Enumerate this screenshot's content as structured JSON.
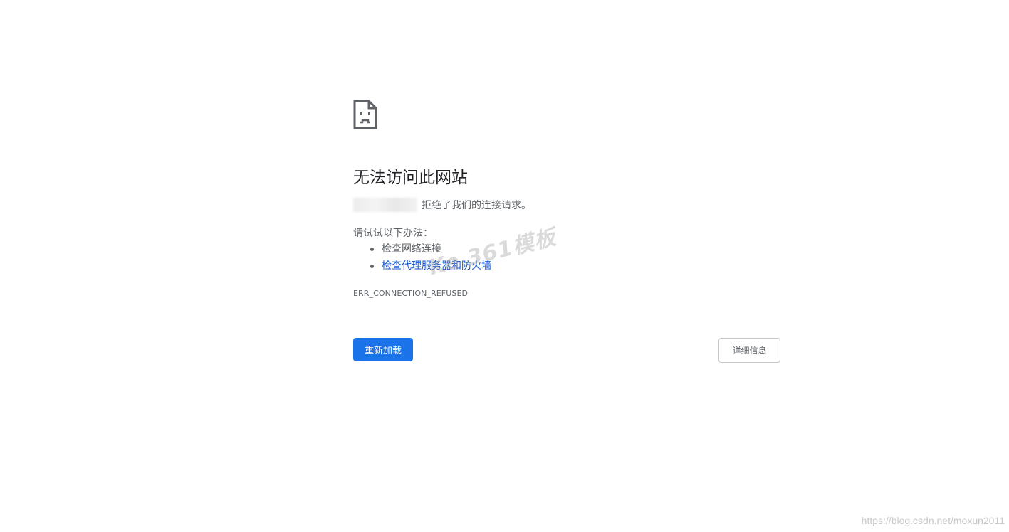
{
  "error_icon": "sad-page-icon",
  "title": "无法访问此网站",
  "summary_text": "拒绝了我们的连接请求。",
  "try_label": "请试试以下办法：",
  "suggestions": [
    {
      "label": "检查网络连接",
      "is_link": false
    },
    {
      "label": "检查代理服务器和防火墙",
      "is_link": true
    }
  ],
  "error_code": "ERR_CONNECTION_REFUSED",
  "reload_label": "重新加载",
  "details_label": "详细信息",
  "watermark_text": "Ke 361模板",
  "footer_watermark": "https://blog.csdn.net/moxun2011",
  "colors": {
    "accent": "#1a73e8",
    "link": "#1558d6",
    "title": "#202124",
    "text": "#5f6368"
  }
}
